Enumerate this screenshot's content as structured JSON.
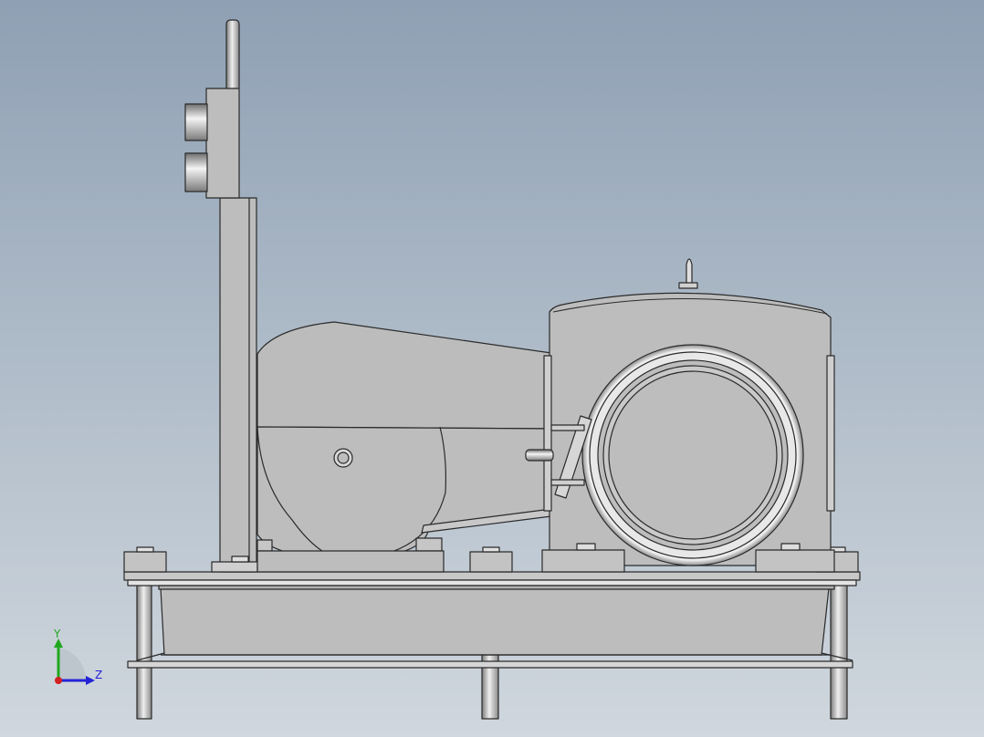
{
  "triad": {
    "y_label": "Y",
    "z_label": "Z",
    "colors": {
      "x": "#d22020",
      "y": "#1fa81f",
      "z": "#2323d6"
    }
  },
  "viewport": {
    "background_top": "#8fa0b4",
    "background_bottom": "#d0d7de",
    "part_fill": "#bdbdbd",
    "edge_color": "#2a2a2a"
  }
}
